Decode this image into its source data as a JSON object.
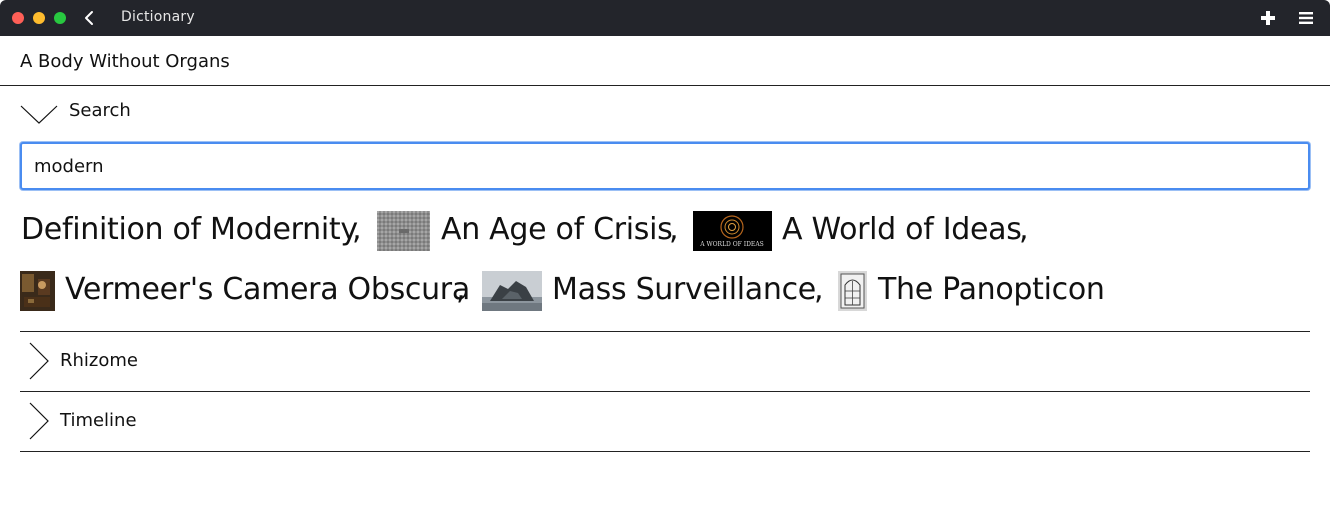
{
  "window": {
    "title": "Dictionary",
    "controls": {
      "close": "#fe5f57",
      "minimize": "#febc2e",
      "zoom": "#28c840"
    }
  },
  "page": {
    "title": "A Body Without Organs"
  },
  "search_section": {
    "label": "Search",
    "input_value": "modern",
    "expanded": true
  },
  "results": [
    {
      "title": "Definition of Modernity",
      "thumbnail": "none"
    },
    {
      "title": "An Age of Crisis",
      "thumbnail": "grey-noise-image"
    },
    {
      "title": "A World of Ideas",
      "thumbnail": "black-orbit-image",
      "thumbnail_caption": "A WORLD OF IDEAS"
    },
    {
      "title": "Vermeer's Camera Obscura",
      "thumbnail": "painting-image"
    },
    {
      "title": "Mass Surveillance",
      "thumbnail": "rock-photo-image"
    },
    {
      "title": "The Panopticon",
      "thumbnail": "panopticon-image"
    }
  ],
  "separator": ",",
  "sections": [
    {
      "label": "Rhizome",
      "expanded": false
    },
    {
      "label": "Timeline",
      "expanded": false
    }
  ],
  "colors": {
    "titlebar": "#23252b",
    "focus": "#4a8cf0"
  }
}
